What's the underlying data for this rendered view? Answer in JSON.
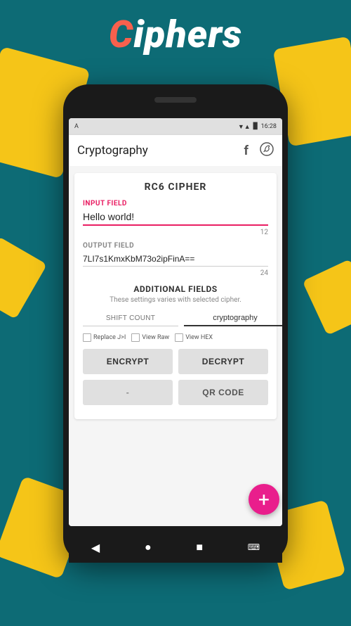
{
  "app": {
    "title_c": "C",
    "title_rest": "iphers"
  },
  "status_bar": {
    "left": "A",
    "signal": "▼▲",
    "battery": "■",
    "time": "16:28"
  },
  "app_bar": {
    "title": "Cryptography",
    "facebook_icon": "f",
    "whatsapp_icon": "✆"
  },
  "card": {
    "title": "RC6 CIPHER",
    "input_label": "INPUT FIELD",
    "input_value": "Hello world!",
    "input_char_count": "12",
    "output_label": "OUTPUT FIELD",
    "output_value": "7LI7s1KmxKbM73o2ipFinA==",
    "output_char_count": "24",
    "additional_title": "ADDITIONAL FIELDS",
    "additional_subtitle": "These settings varies with selected cipher.",
    "shift_count_placeholder": "SHIFT COUNT",
    "cryptography_value": "cryptography",
    "checkbox1_label": "Replace J>I",
    "checkbox2_label": "View Raw",
    "checkbox3_label": "View HEX",
    "encrypt_label": "ENCRYPT",
    "decrypt_label": "DECRYPT",
    "secondary_label": "-",
    "qrcode_label": "QR CODE"
  },
  "fab": {
    "icon": "+"
  },
  "nav": {
    "back": "◀",
    "home": "●",
    "recents": "■",
    "keyboard": "⌨"
  }
}
